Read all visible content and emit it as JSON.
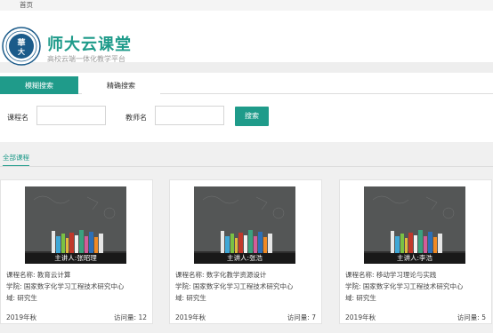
{
  "nav": {
    "home": "首页"
  },
  "header": {
    "title": "师大云课堂",
    "subtitle": "高校云端一体化教学平台",
    "logo_char": "華大",
    "colors": {
      "brand": "#1f9b8a",
      "logo": "#1b5b8a"
    }
  },
  "tabs": [
    {
      "label": "模糊搜索",
      "active": true
    },
    {
      "label": "精确搜索",
      "active": false
    }
  ],
  "search": {
    "course_label": "课程名",
    "course_value": "",
    "teacher_label": "教师名",
    "teacher_value": "",
    "button": "搜索"
  },
  "section": {
    "title": "全部课程"
  },
  "courses": [
    {
      "lecturer": "主讲人:张昭理",
      "name_key": "课程名称:",
      "name": "教育云计算",
      "college_key": "学院:",
      "college": "国家数字化学习工程技术研究中心",
      "field_key": "域:",
      "field": "研究生",
      "term": "2019年秋",
      "views_key": "访问量:",
      "views": "12"
    },
    {
      "lecturer": "主讲人:张浩",
      "name_key": "课程名称:",
      "name": "数字化教学资源设计",
      "college_key": "学院:",
      "college": "国家数字化学习工程技术研究中心",
      "field_key": "域:",
      "field": "研究生",
      "term": "2019年秋",
      "views_key": "访问量:",
      "views": "7"
    },
    {
      "lecturer": "主讲人:李浩",
      "name_key": "课程名称:",
      "name": "移动学习理论与实践",
      "college_key": "学院:",
      "college": "国家数字化学习工程技术研究中心",
      "field_key": "域:",
      "field": "研究生",
      "term": "2019年秋",
      "views_key": "访问量:",
      "views": "5"
    }
  ]
}
